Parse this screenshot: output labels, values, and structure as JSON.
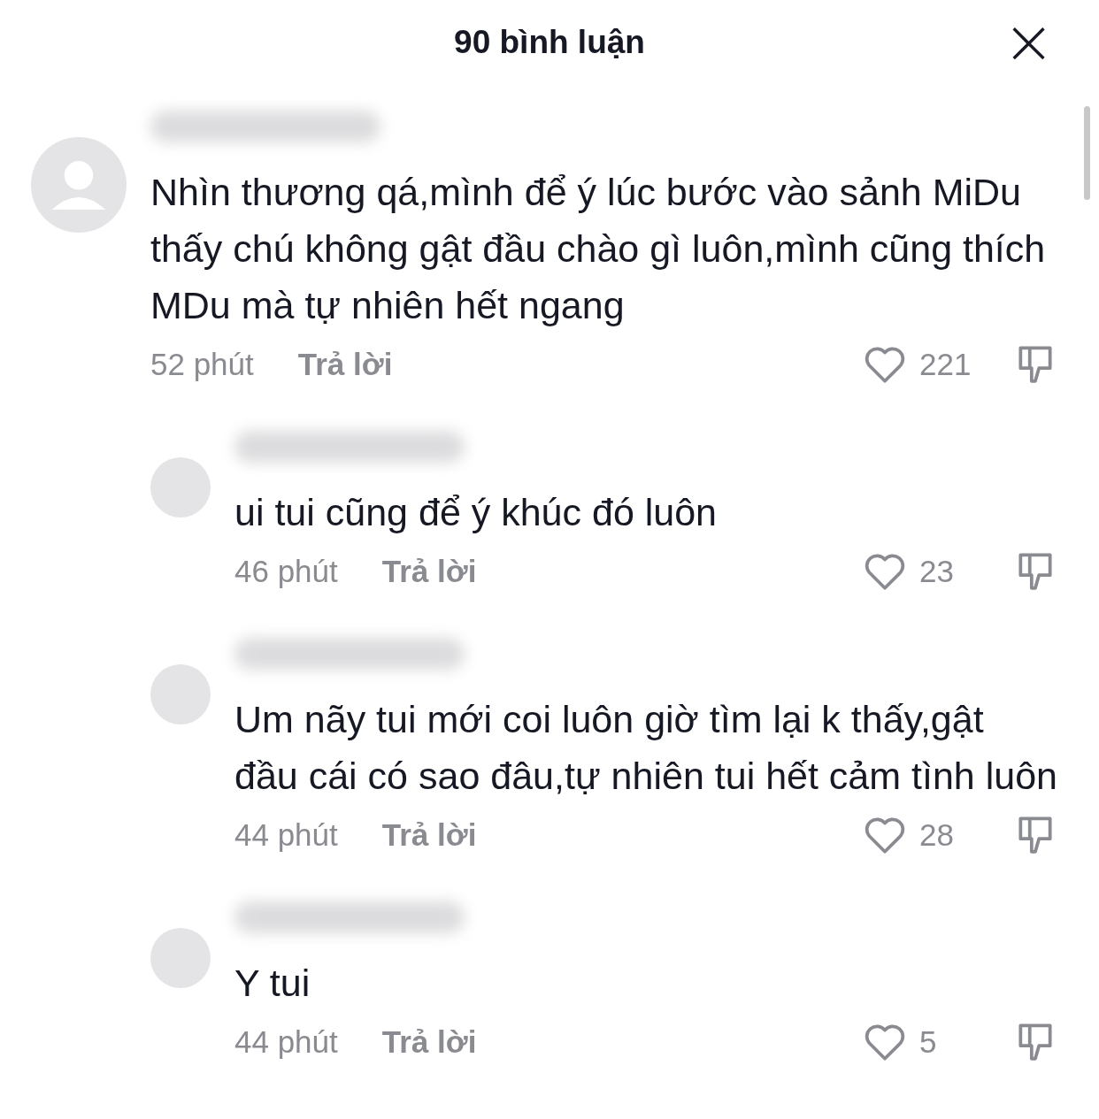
{
  "header": {
    "title": "90 bình luận",
    "close": "×"
  },
  "comments": [
    {
      "text": "Nhìn thương qá,mình để ý lúc bước vào sảnh MiDu thấy chú không gật đầu chào gì luôn,mình cũng thích MDu mà tự nhiên hết ngang",
      "time": "52 phút",
      "reply_label": "Trả lời",
      "likes": "221",
      "replies": [
        {
          "text": "ui tui cũng để ý khúc đó luôn",
          "time": "46 phút",
          "reply_label": "Trả lời",
          "likes": "23"
        },
        {
          "text": "Um nãy tui mới coi luôn giờ tìm lại k thấy,gật đầu cái có sao đâu,tự nhiên tui hết cảm tình luôn",
          "time": "44 phút",
          "reply_label": "Trả lời",
          "likes": "28"
        },
        {
          "text": "Y tui",
          "time": "44 phút",
          "reply_label": "Trả lời",
          "likes": "5"
        }
      ]
    }
  ]
}
